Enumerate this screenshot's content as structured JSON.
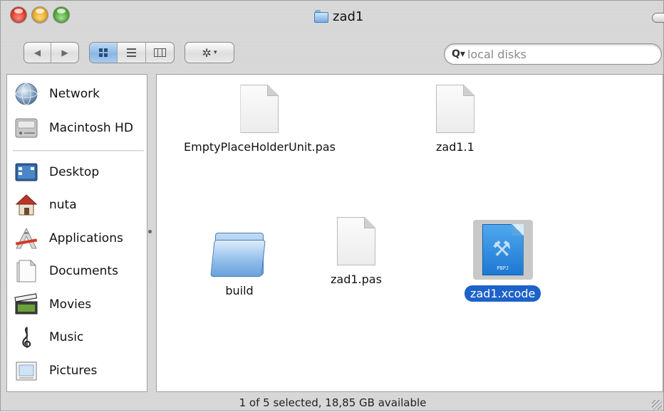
{
  "window": {
    "title": "zad1"
  },
  "toolbar": {
    "back_glyph": "◀",
    "forward_glyph": "▶",
    "view_modes": [
      {
        "name": "icon-view",
        "active": true
      },
      {
        "name": "list-view",
        "active": false
      },
      {
        "name": "column-view",
        "active": false
      }
    ],
    "action_glyph": "✲",
    "action_caret": "▾"
  },
  "search": {
    "placeholder": "local disks",
    "icon_glyph": "Q▾"
  },
  "sidebar": {
    "devices": [
      {
        "label": "Network",
        "icon": "network-icon"
      },
      {
        "label": "Macintosh HD",
        "icon": "hard-drive-icon"
      }
    ],
    "places": [
      {
        "label": "Desktop",
        "icon": "desktop-icon"
      },
      {
        "label": "nuta",
        "icon": "home-icon"
      },
      {
        "label": "Applications",
        "icon": "applications-icon"
      },
      {
        "label": "Documents",
        "icon": "documents-icon"
      },
      {
        "label": "Movies",
        "icon": "movies-icon"
      },
      {
        "label": "Music",
        "icon": "music-icon"
      },
      {
        "label": "Pictures",
        "icon": "pictures-icon"
      }
    ]
  },
  "files": [
    {
      "name": "EmptyPlaceHolderUnit.pas",
      "kind": "document",
      "selected": false
    },
    {
      "name": "zad1.1",
      "kind": "document",
      "selected": false
    },
    {
      "name": "build",
      "kind": "folder",
      "selected": false
    },
    {
      "name": "zad1.pas",
      "kind": "document",
      "selected": false
    },
    {
      "name": "zad1.xcode",
      "kind": "xcode-project",
      "selected": true
    }
  ],
  "xcode_badge": "PBPJ",
  "status": {
    "text": "1 of 5 selected, 18,85 GB available"
  },
  "colors": {
    "selection": "#1d62c9",
    "window_chrome": "#d8d8d8"
  }
}
